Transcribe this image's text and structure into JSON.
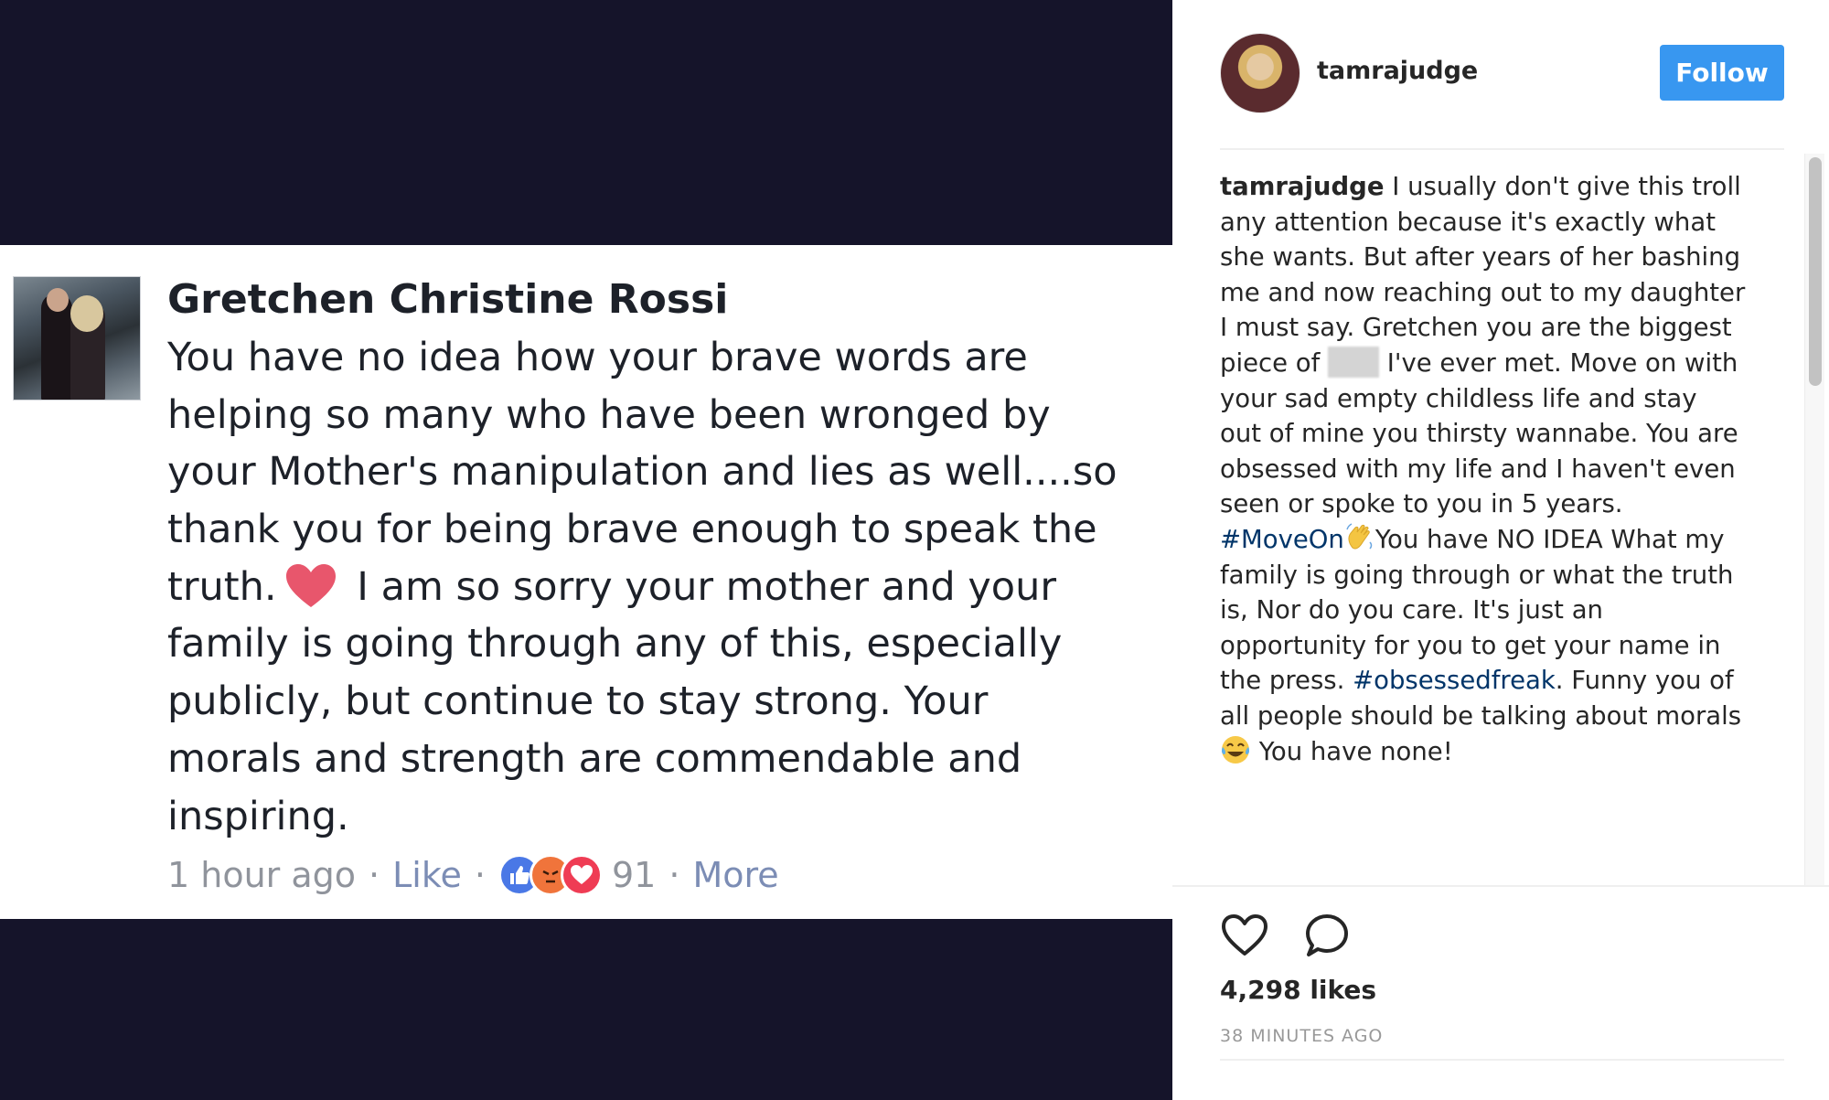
{
  "post_image": {
    "commenter_name": "Gretchen Christine Rossi",
    "comment_lines": [
      "You have no idea how your brave words are",
      "helping so many who have been wronged by",
      "your Mother's manipulation and lies as well....so",
      "thank you for being brave enough to speak the",
      "truth.",
      " I am so sorry your mother and your",
      "family is going through any of this, especially",
      "publicly, but continue to stay strong. Your",
      "morals and strength are commendable and",
      "inspiring."
    ],
    "comment_meta": {
      "time": "1 hour ago",
      "like_label": "Like",
      "reaction_count": "91",
      "more_label": "More",
      "separator": "·"
    },
    "icons": [
      "heart-emoji",
      "like-reaction",
      "angry-reaction",
      "love-reaction"
    ]
  },
  "header": {
    "username": "tamrajudge",
    "follow_label": "Follow"
  },
  "caption": {
    "username": "tamrajudge",
    "l1": " I usually don't give this troll",
    "l2": "any attention because it's exactly what",
    "l3": "she wants. But after years of her bashing",
    "l4": "me and now reaching out to my daughter",
    "l5": "I must say. Gretchen you are the biggest",
    "l6_pre": "piece of ",
    "l6_post": " I've ever met. Move on with",
    "l7": "your sad empty childless life and stay",
    "l8": "out of mine you thirsty wannabe. You are",
    "l9": "obsessed with my life and I haven't even",
    "l10": "seen or spoke to you in 5 years.",
    "hashtag1": "#MoveOn",
    "l11_post": "You have NO IDEA What my",
    "l12": "family is going through or what the truth",
    "l13": "is, Nor do you care. It's just an",
    "l14": "opportunity for you to get your name in",
    "l15_pre": "the press. ",
    "hashtag2": "#obsessedfreak",
    "l15_post": ". Funny you of",
    "l16": "all people should be talking about morals",
    "l17_post": " You have none!"
  },
  "footer": {
    "likes": "4,298 likes",
    "timestamp": "38 MINUTES AGO"
  },
  "colors": {
    "follow_button": "#3897f0",
    "hashtag": "#003569",
    "band": "#15142a"
  }
}
